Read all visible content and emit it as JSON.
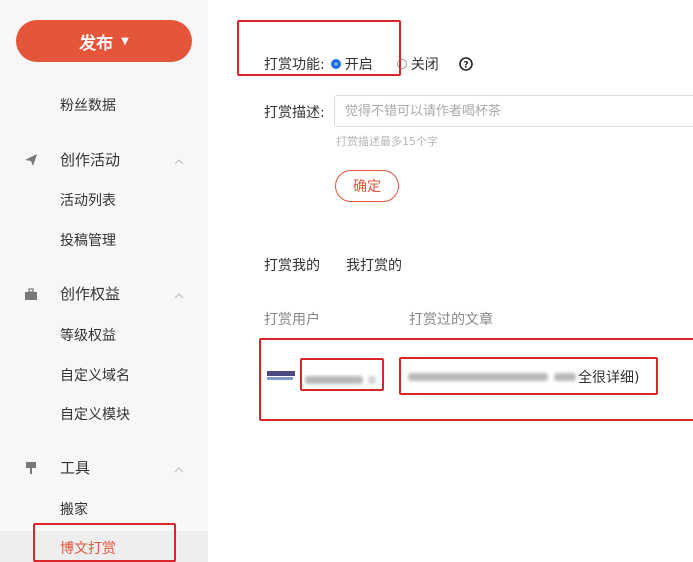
{
  "sidebar": {
    "publish_label": "发布",
    "fans_label": "粉丝数据",
    "section_activities": "创作活动",
    "activity_list": "活动列表",
    "submission_manage": "投稿管理",
    "section_rights": "创作权益",
    "level_rights": "等级权益",
    "custom_domain": "自定义域名",
    "custom_module": "自定义模块",
    "section_tools": "工具",
    "move_house": "搬家",
    "blog_reward": "博文打赏"
  },
  "reward": {
    "function_label": "打赏功能:",
    "option_on": "开启",
    "option_off": "关闭",
    "desc_label": "打赏描述:",
    "desc_placeholder": "觉得不错可以请作者喝杯茶",
    "desc_hint": "打赏描述最多15个字",
    "confirm_label": "确定"
  },
  "tabs": {
    "rewarded_me": "打赏我的",
    "i_rewarded": "我打赏的"
  },
  "table": {
    "col_user": "打赏用户",
    "col_article": "打赏过的文章",
    "row_article_suffix": "全很详细)"
  },
  "colors": {
    "brand": "#e4553a",
    "highlight_box": "#d9262b",
    "radio_selected": "#1f6fe5"
  }
}
